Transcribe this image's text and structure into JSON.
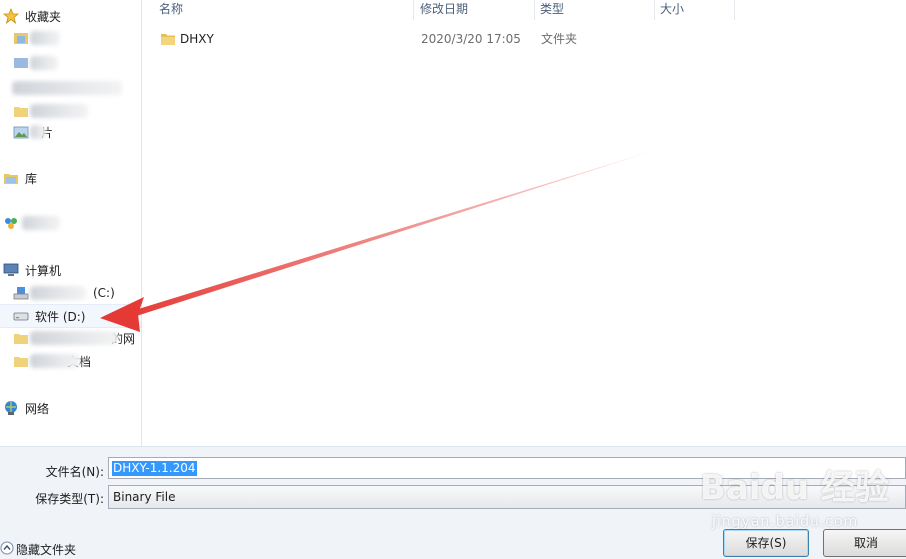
{
  "nav": {
    "favorites": "收藏夹",
    "fav_pictures_suffix": "片",
    "libraries": "库",
    "homegroup_partial": "家庭组",
    "computer": "计算机",
    "drive_c_suffix": "(C:)",
    "drive_d": "软件 (D:)",
    "folder1_partial": "的网",
    "folder2_partial": "文档",
    "network": "网络"
  },
  "columns": {
    "name": "名称",
    "modified": "修改日期",
    "type": "类型",
    "size": "大小"
  },
  "files": [
    {
      "name": "DHXY",
      "modified": "2020/3/20 17:05",
      "type": "文件夹",
      "size": ""
    }
  ],
  "form": {
    "filename_label": "文件名(N):",
    "filename_value": "DHXY-1.1.204",
    "filetype_label": "保存类型(T):",
    "filetype_value": "Binary File"
  },
  "buttons": {
    "save": "保存(S)",
    "cancel": "取消"
  },
  "hide_folders": "隐藏文件夹",
  "watermark": {
    "logo": "Baidu 经验",
    "url": "jingyan.baidu.com"
  },
  "annotation_color": "#e53935"
}
